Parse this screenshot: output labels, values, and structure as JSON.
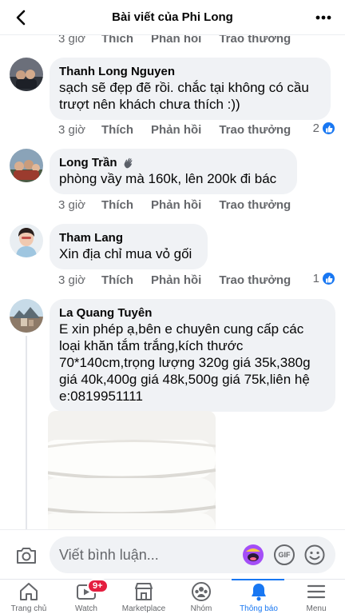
{
  "header": {
    "title": "Bài viết của Phi Long"
  },
  "actions": {
    "like": "Thích",
    "reply": "Phản hồi",
    "reward": "Trao thưởng"
  },
  "top_meta": {
    "time": "3 giờ"
  },
  "comments": [
    {
      "author": "Thanh Long Nguyen",
      "text": "sạch sẽ đẹp đẽ rồi. chắc tại không có cầu trượt nên khách chưa thích :))",
      "time": "3 giờ",
      "reactions": "2"
    },
    {
      "author": "Long Trần",
      "text": "phòng vầy mà 160k, lên 200k đi bác",
      "time": "3 giờ",
      "reactions": ""
    },
    {
      "author": "Tham Lang",
      "text": "Xin địa chỉ mua vỏ gối",
      "time": "3 giờ",
      "reactions": "1"
    },
    {
      "author": "La Quang Tuyên",
      "text": "E xin phép ạ,bên e chuyên cung cấp các loại khăn tắm trắng,kích thước 70*140cm,trọng lượng 320g giá 35k,380g giá 40k,400g giá 48k,500g giá 75k,liên hệ e:0819951111",
      "time": "",
      "reactions": ""
    }
  ],
  "composer": {
    "placeholder": "Viết bình luận..."
  },
  "tabs": [
    {
      "label": "Trang chủ",
      "icon": "home-icon"
    },
    {
      "label": "Watch",
      "icon": "watch-icon",
      "badge": "9+"
    },
    {
      "label": "Marketplace",
      "icon": "marketplace-icon"
    },
    {
      "label": "Nhóm",
      "icon": "groups-icon"
    },
    {
      "label": "Thông báo",
      "icon": "bell-icon",
      "active": true
    },
    {
      "label": "Menu",
      "icon": "menu-icon"
    }
  ],
  "colors": {
    "accent": "#1877f2",
    "bubble": "#f0f2f5",
    "muted": "#65676b",
    "badge": "#e41e3f"
  }
}
